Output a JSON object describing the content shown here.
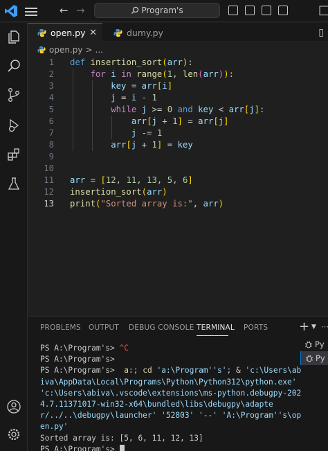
{
  "titlebar": {
    "search_text": "Program's"
  },
  "tabs": [
    {
      "label": "open.py",
      "active": true
    },
    {
      "label": "dumy.py",
      "active": false
    }
  ],
  "breadcrumb": {
    "file": "open.py",
    "separator": ">",
    "rest": "..."
  },
  "editor": {
    "current_line": 13,
    "line_numbers": [
      "1",
      "2",
      "3",
      "4",
      "5",
      "6",
      "7",
      "8",
      "9",
      "10",
      "11",
      "12",
      "13"
    ],
    "code": {
      "l1_kw": "def",
      "l1_fn": "insertion_sort",
      "l1_param": "arr",
      "l1_end": ":",
      "l2_for": "for",
      "l2_i": "i",
      "l2_in": "in",
      "l2_range": "range",
      "l2_one": "1",
      "l2_len": "len",
      "l2_arr": "arr",
      "l2_end": ":",
      "l3_key": "key",
      "l3_eq": " = ",
      "l3_arr": "arr",
      "l3_i": "i",
      "l4_j": "j",
      "l4_eq": " = ",
      "l4_i": "i",
      "l4_minus": " - ",
      "l4_one": "1",
      "l5_while": "while",
      "l5_j": "j",
      "l5_ge": " >= ",
      "l5_zero": "0",
      "l5_and": "and",
      "l5_key": "key",
      "l5_lt": " < ",
      "l5_arr": "arr",
      "l5_jj": "j",
      "l5_end": ":",
      "l6_arr": "arr",
      "l6_j": "j",
      "l6_plus": " + ",
      "l6_one": "1",
      "l6_eq": " = ",
      "l6_arr2": "arr",
      "l6_j2": "j",
      "l7_j": "j",
      "l7_op": " -= ",
      "l7_one": "1",
      "l8_arr": "arr",
      "l8_j": "j",
      "l8_plus": " + ",
      "l8_one": "1",
      "l8_eq": " = ",
      "l8_key": "key",
      "l11_arr": "arr",
      "l11_eq": " = ",
      "l11_n1": "12",
      "l11_n2": "11",
      "l11_n3": "13",
      "l11_n4": "5",
      "l11_n5": "6",
      "l12_fn": "insertion_sort",
      "l12_arr": "arr",
      "l13_fn": "print",
      "l13_str": "\"Sorted array is:\"",
      "l13_arr": "arr"
    }
  },
  "panel": {
    "tabs": [
      "PROBLEMS",
      "OUTPUT",
      "DEBUG CONSOLE",
      "TERMINAL",
      "PORTS"
    ],
    "active_tab": "TERMINAL",
    "add_label": "+",
    "terminal_list": [
      "Py",
      "Py"
    ],
    "terminal": {
      "prompt": "PS A:\\Program's> ",
      "ctrl_c": "^C",
      "cmd_a": "a:",
      "cmd_sep": "; ",
      "cmd_cd": "cd",
      "cmd_path1": "'a:\\Program''s'",
      "cmd_amp": "; & ",
      "cmd_python": "'c:\\Users\\abiva\\AppData\\Local\\Programs\\Python\\Python312\\python.exe'",
      "cmd_launcher": "'c:\\Users\\abiva\\.vscode\\extensions\\ms-python.debugpy-2024.7.11371017-win32-x64\\bundled\\libs\\debugpy\\adapter/../..\\debugpy\\launcher'",
      "cmd_port": "'52803'",
      "cmd_dd": "'--'",
      "cmd_file": "'A:\\Program''s\\open.py'",
      "output": "Sorted array is: [5, 6, 11, 12, 13]"
    }
  },
  "colors": {
    "accent": "#0078d4",
    "background": "#1f1f1f"
  }
}
